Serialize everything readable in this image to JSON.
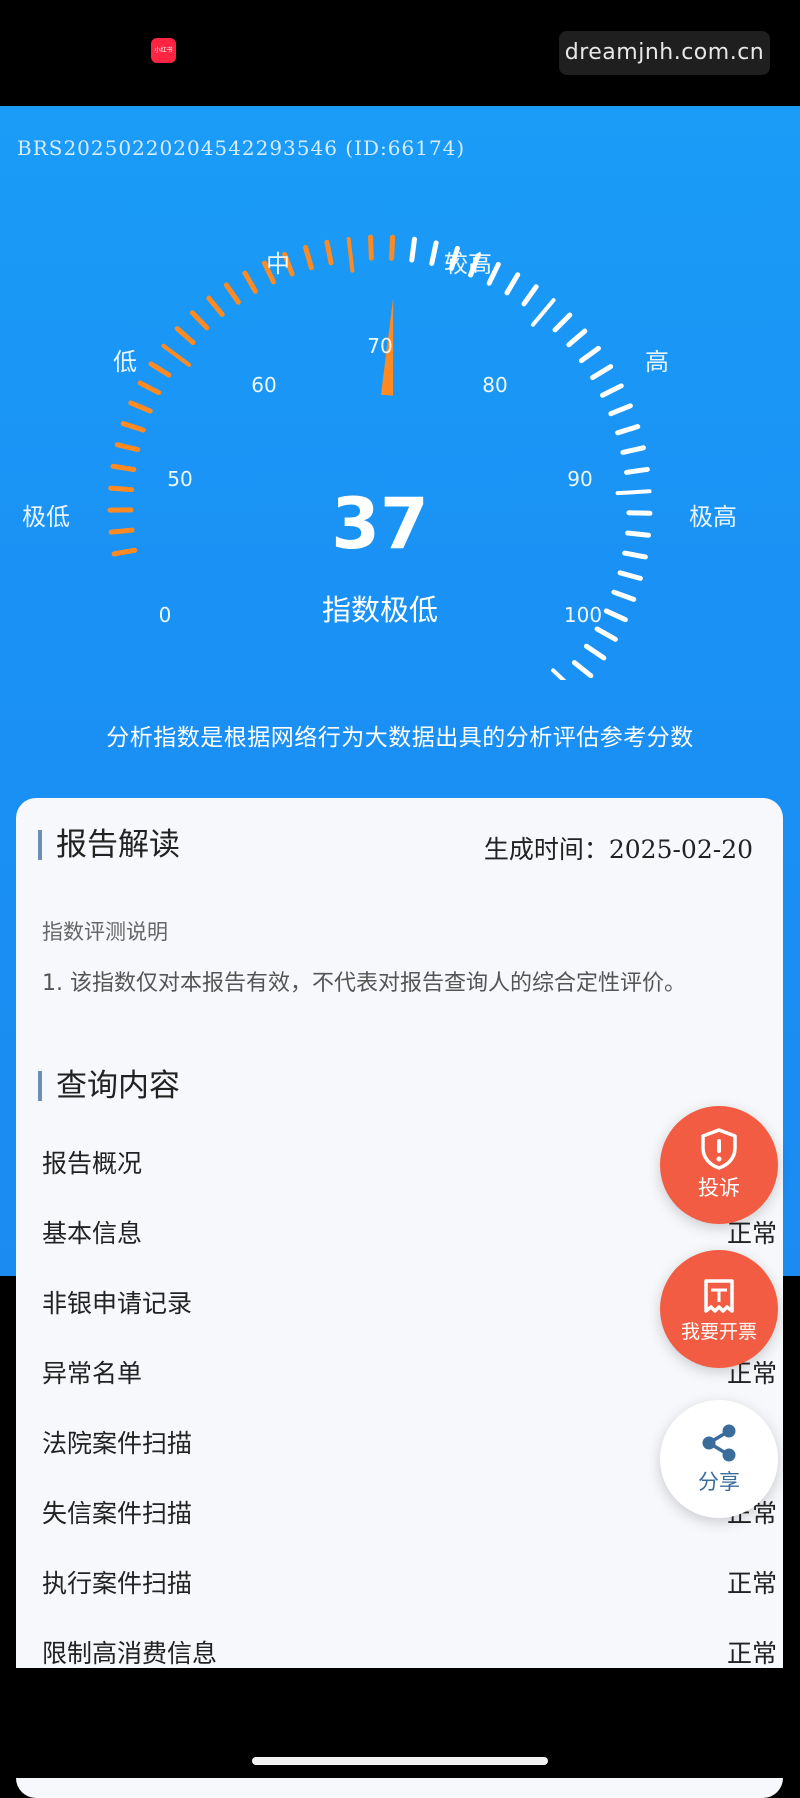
{
  "status_bar": {
    "app_badge": "小红书",
    "watermark": "dreamjnh.com.cn"
  },
  "report": {
    "id_line": "BRS20250220204542293546 (ID:66174)"
  },
  "gauge": {
    "score": "37",
    "score_value": 37,
    "level_text": "指数极低",
    "scale_min": 0,
    "scale_max": 100,
    "scale_labels": [
      "0",
      "50",
      "60",
      "70",
      "80",
      "90",
      "100"
    ],
    "zones": [
      "极低",
      "低",
      "中",
      "较高",
      "高",
      "极高"
    ],
    "colors": {
      "active": "#ff8a22",
      "inactive": "#ffffff"
    }
  },
  "notice": "分析指数是根据网络行为大数据出具的分析评估参考分数",
  "card": {
    "title": "报告解读",
    "gen_time_label": "生成时间：",
    "gen_time_value": "2025-02-20",
    "sub_label": "指数评测说明",
    "explanation": "1. 该指数仅对本报告有效，不代表对报告查询人的综合定性评价。",
    "query_title": "查询内容",
    "rows": [
      {
        "label": "报告概况",
        "status": ""
      },
      {
        "label": "基本信息",
        "status": "正常"
      },
      {
        "label": "非银申请记录",
        "status": ""
      },
      {
        "label": "异常名单",
        "status": "正常"
      },
      {
        "label": "法院案件扫描",
        "status": ""
      },
      {
        "label": "失信案件扫描",
        "status": "正常"
      },
      {
        "label": "执行案件扫描",
        "status": "正常"
      },
      {
        "label": "限制高消费信息",
        "status": "正常"
      }
    ]
  },
  "fabs": {
    "complaint": "投诉",
    "invoice": "我要开票",
    "share": "分享"
  }
}
